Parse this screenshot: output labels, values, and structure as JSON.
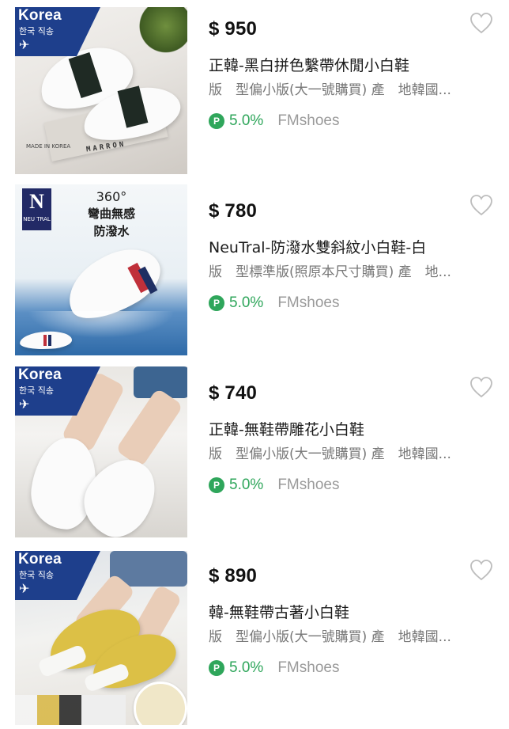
{
  "badges": {
    "korea_title": "Korea",
    "korea_subtitle": "한국 직송",
    "plane_glyph": "✈",
    "neutral_letter": "N",
    "neutral_name": "NEU TRAL",
    "promo_line1": "360°",
    "promo_line2": "彎曲無感",
    "promo_line3": "防潑水",
    "made_in": "MADE IN KOREA",
    "marron": "MARRON"
  },
  "colors": {
    "price": "#111111",
    "rate": "#2fa65b",
    "shop": "#9a9a9a",
    "korea_badge": "#1e3f8c",
    "heart_outline": "#bdbdbd"
  },
  "icons": {
    "wishlist": "heart-outline-icon",
    "points": "p-points-icon",
    "shipping": "airplane-icon"
  },
  "products": [
    {
      "price": "$ 950",
      "title": "正韓-黑白拼色繫帶休閒小白鞋",
      "spec": "版　型偏小版(大一號購買) 產　地韓國...",
      "badge": "P",
      "rate": "5.0%",
      "shop": "FMshoes"
    },
    {
      "price": "$ 780",
      "title": "NeuTral-防潑水雙斜紋小白鞋-白",
      "spec": "版　型標準版(照原本尺寸購買) 產　地...",
      "badge": "P",
      "rate": "5.0%",
      "shop": "FMshoes"
    },
    {
      "price": "$ 740",
      "title": "正韓-無鞋帶雕花小白鞋",
      "spec": "版　型偏小版(大一號購買) 產　地韓國...",
      "badge": "P",
      "rate": "5.0%",
      "shop": "FMshoes"
    },
    {
      "price": "$ 890",
      "title": "韓-無鞋帶古著小白鞋",
      "spec": "版　型偏小版(大一號購買) 產　地韓國...",
      "badge": "P",
      "rate": "5.0%",
      "shop": "FMshoes"
    }
  ]
}
